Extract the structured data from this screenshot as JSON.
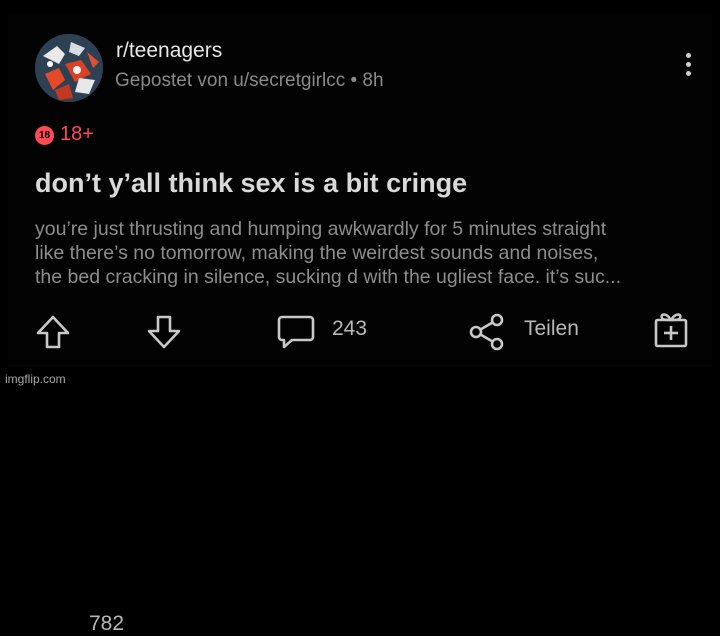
{
  "post": {
    "subreddit": "r/teenagers",
    "meta": "Gepostet von u/secretgirlcc • 8h",
    "nsfw_badge_icon": "18",
    "nsfw_label": "18+",
    "title": "don’t y’all think sex is a bit cringe",
    "body_lines": [
      "you’re just thrusting and humping awkwardly for 5 minutes straight",
      "like there’s no tomorrow, making the weirdest sounds and noises,",
      "the bed cracking in silence, sucking d with the ugliest face. it’s suc..."
    ]
  },
  "actions": {
    "upvote_icon": "arrow-up-icon",
    "score": "782",
    "downvote_icon": "arrow-down-icon",
    "comment_icon": "comment-bubble-icon",
    "comments": "243",
    "share_icon": "share-icon",
    "share_label": "Teilen",
    "award_icon": "gift-award-icon"
  },
  "watermark": "imgflip.com",
  "colors": {
    "background": "#000000",
    "nsfw_accent": "#ff4a55",
    "title": "#d9d9d9",
    "body": "#8d8d8d",
    "meta": "#8a8a8a"
  }
}
